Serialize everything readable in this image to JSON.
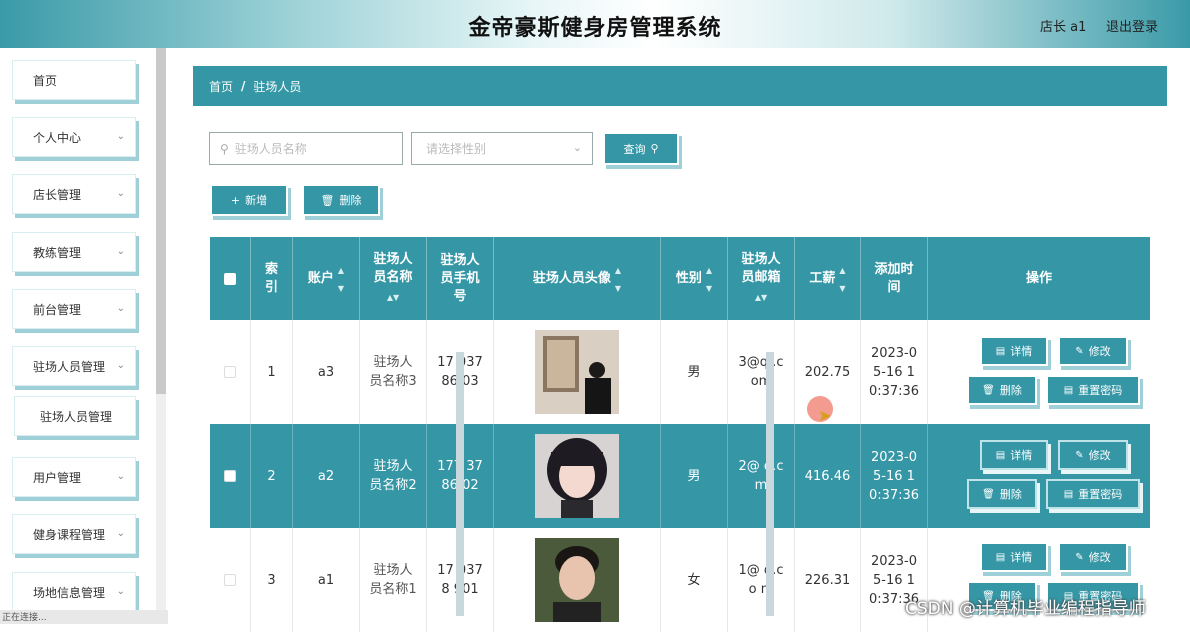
{
  "header": {
    "title": "金帝豪斯健身房管理系统",
    "user": "店长 a1",
    "logout": "退出登录"
  },
  "sidebar": {
    "items": [
      {
        "label": "首页",
        "has_chevron": false
      },
      {
        "label": "个人中心",
        "has_chevron": true
      },
      {
        "label": "店长管理",
        "has_chevron": true
      },
      {
        "label": "教练管理",
        "has_chevron": true
      },
      {
        "label": "前台管理",
        "has_chevron": true
      },
      {
        "label": "驻场人员管理",
        "has_chevron": true
      },
      {
        "label": "驻场人员管理",
        "has_chevron": false,
        "sub": true
      },
      {
        "label": "用户管理",
        "has_chevron": true
      },
      {
        "label": "健身课程管理",
        "has_chevron": true
      },
      {
        "label": "场地信息管理",
        "has_chevron": true
      }
    ],
    "chevron": "⌄"
  },
  "status_bar": "正在连接...",
  "breadcrumb": {
    "home": "首页",
    "separator": "/",
    "current": "驻场人员"
  },
  "search": {
    "name_placeholder": "驻场人员名称",
    "gender_placeholder": "请选择性别",
    "query_label": "查询",
    "add_label": "新增",
    "delete_label": "删除"
  },
  "table": {
    "columns": [
      "",
      "索引",
      "账户",
      "驻场人员名称",
      "驻场人员手机号",
      "驻场人员头像",
      "性别",
      "驻场人员邮箱",
      "工薪",
      "添加时间",
      "操作"
    ],
    "col_labels": {
      "index": "索\n引",
      "account": "账户",
      "name": "驻场人\n员名称",
      "phone": "驻场人\n员手机\n号",
      "avatar": "驻场人员头像",
      "gender": "性别",
      "email": "驻场人\n员邮箱",
      "salary": "工薪",
      "time": "添加时\n间",
      "actions": "操作"
    },
    "rows": [
      {
        "index": "1",
        "account": "a3",
        "name": "驻场人\n员名称3",
        "phone": "17 037\n86 03",
        "gender": "男",
        "email": "3@q .c\nom",
        "salary": "202.75",
        "time": "2023-0\n5-16 1\n0:37:36"
      },
      {
        "index": "2",
        "account": "a2",
        "name": "驻场人\n员名称2",
        "phone": "177 37\n86 02",
        "gender": "男",
        "email": "2@ q.c\n m",
        "salary": "416.46",
        "time": "2023-0\n5-16 1\n0:37:36"
      },
      {
        "index": "3",
        "account": "a1",
        "name": "驻场人\n员名称1",
        "phone": "17 037\n8 901",
        "gender": "女",
        "email": "1@ q.c\no m",
        "salary": "226.31",
        "time": "2023-0\n5-16 1\n0:37:36"
      }
    ],
    "actions": {
      "detail": "详情",
      "edit": "修改",
      "delete": "删除",
      "reset": "重置密码"
    }
  },
  "watermark": "CSDN @计算机毕业编程指导师",
  "colors": {
    "accent": "#3597a6",
    "shadow": "#9fd0d8"
  }
}
